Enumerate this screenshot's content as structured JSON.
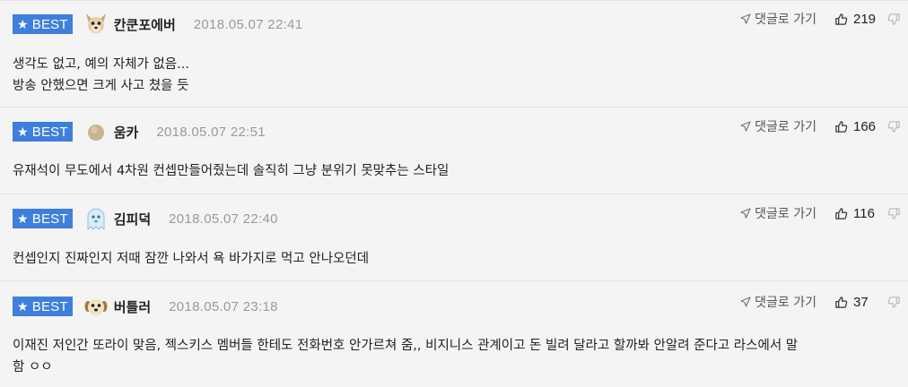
{
  "comments": [
    {
      "badge": "BEST",
      "nickname": "칸쿤포에버",
      "date": "2018.05.07 22:41",
      "reply_label": "댓글로 가기",
      "likes": "219",
      "lines": [
        "생각도 없고, 예의 자체가 없음...",
        "방송 안했으면 크게 사고 쳤을 듯"
      ],
      "avatar": "chihuahua-avatar"
    },
    {
      "badge": "BEST",
      "nickname": "움카",
      "date": "2018.05.07 22:51",
      "reply_label": "댓글로 가기",
      "likes": "166",
      "lines": [
        "유재석이 무도에서 4차원 컨셉만들어줬는데 솔직히 그냥 분위기 못맞추는 스타일"
      ],
      "avatar": "beige-dot-avatar"
    },
    {
      "badge": "BEST",
      "nickname": "김피덕",
      "date": "2018.05.07 22:40",
      "reply_label": "댓글로 가기",
      "likes": "116",
      "lines": [
        "컨셉인지 진짜인지 저때 잠깐 나와서 욕 바가지로 먹고 안나오던데"
      ],
      "avatar": "ghost-avatar"
    },
    {
      "badge": "BEST",
      "nickname": "버틀러",
      "date": "2018.05.07 23:18",
      "reply_label": "댓글로 가기",
      "likes": "37",
      "lines": [
        "이재진 저인간 또라이 맞음, 젝스키스 멤버들 한테도 전화번호 안가르쳐 줌,, 비지니스 관계이고 돈 빌려 달라고 할까봐 안알려 준다고 라스에서 말",
        "함 ㅇㅇ"
      ],
      "avatar": "puppy-avatar"
    }
  ],
  "colors": {
    "badge_bg": "#3f7fdc",
    "date": "#9a9a9a",
    "background": "#f6f6f6"
  }
}
